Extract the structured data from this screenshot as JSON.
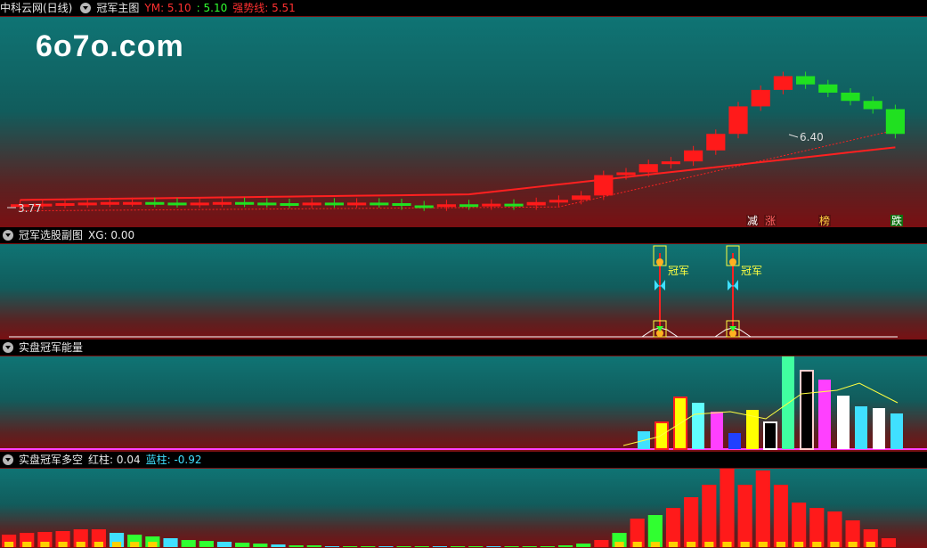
{
  "main": {
    "title": "中科云网(日线)",
    "indicator": "冠军主图",
    "ym_label": "YM: 5.10",
    "ym_value": ": 5.10",
    "strong_label": "强势线: 5.51",
    "logo": "6o7o.com",
    "high_label": "6.40",
    "low_label": "3.77",
    "signals": [
      "减",
      "涨",
      "榜",
      "跌"
    ],
    "colors": {
      "up": "#ff1a1a",
      "down": "#20e020",
      "line": "#ff2020"
    }
  },
  "sub1": {
    "indicator": "冠军选股副图",
    "value": "XG: 0.00",
    "marks": [
      "冠军",
      "冠军"
    ]
  },
  "sub2": {
    "indicator": "实盘冠军能量"
  },
  "sub3": {
    "indicator": "实盘冠军多空",
    "red_label": "红柱: 0.04",
    "blue_label": "蓝柱: -0.92"
  },
  "chart_data": {
    "type": "candlestick",
    "candles": [
      {
        "o": 3.8,
        "c": 3.82
      },
      {
        "o": 3.82,
        "c": 3.83
      },
      {
        "o": 3.83,
        "c": 3.84
      },
      {
        "o": 3.84,
        "c": 3.85
      },
      {
        "o": 3.85,
        "c": 3.86
      },
      {
        "o": 3.86,
        "c": 3.86
      },
      {
        "o": 3.86,
        "c": 3.85
      },
      {
        "o": 3.85,
        "c": 3.84
      },
      {
        "o": 3.84,
        "c": 3.85
      },
      {
        "o": 3.85,
        "c": 3.86
      },
      {
        "o": 3.86,
        "c": 3.85
      },
      {
        "o": 3.85,
        "c": 3.84
      },
      {
        "o": 3.84,
        "c": 3.83
      },
      {
        "o": 3.83,
        "c": 3.85
      },
      {
        "o": 3.85,
        "c": 3.84
      },
      {
        "o": 3.84,
        "c": 3.85
      },
      {
        "o": 3.85,
        "c": 3.84
      },
      {
        "o": 3.84,
        "c": 3.8
      },
      {
        "o": 3.8,
        "c": 3.78
      },
      {
        "o": 3.78,
        "c": 3.82
      },
      {
        "o": 3.82,
        "c": 3.8
      },
      {
        "o": 3.8,
        "c": 3.83
      },
      {
        "o": 3.83,
        "c": 3.8
      },
      {
        "o": 3.8,
        "c": 3.86
      },
      {
        "o": 3.86,
        "c": 3.9
      },
      {
        "o": 3.9,
        "c": 3.98
      },
      {
        "o": 3.98,
        "c": 4.35
      },
      {
        "o": 4.35,
        "c": 4.4
      },
      {
        "o": 4.4,
        "c": 4.55
      },
      {
        "o": 4.55,
        "c": 4.6
      },
      {
        "o": 4.6,
        "c": 4.8
      },
      {
        "o": 4.8,
        "c": 5.1
      },
      {
        "o": 5.1,
        "c": 5.6
      },
      {
        "o": 5.6,
        "c": 5.9
      },
      {
        "o": 5.9,
        "c": 6.15
      },
      {
        "o": 6.15,
        "c": 6.0
      },
      {
        "o": 6.0,
        "c": 5.85
      },
      {
        "o": 5.85,
        "c": 5.7
      },
      {
        "o": 5.7,
        "c": 5.55
      },
      {
        "o": 5.55,
        "c": 5.1
      }
    ],
    "ylim": [
      3.5,
      7.0
    ]
  }
}
